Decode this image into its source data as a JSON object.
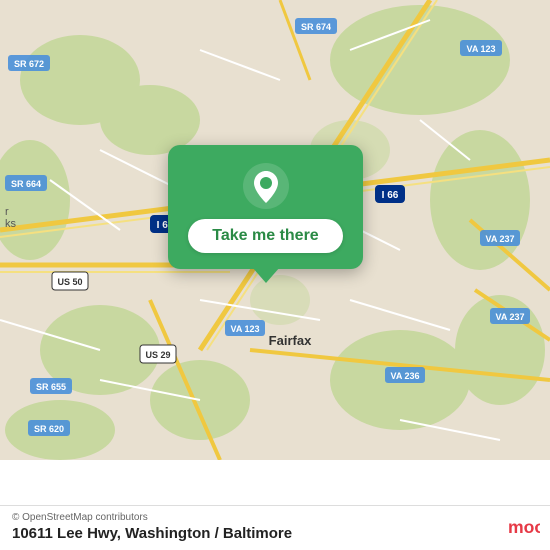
{
  "map": {
    "background_color": "#e8e0d0",
    "alt": "Map of Fairfax VA area showing 10611 Lee Hwy"
  },
  "popup": {
    "button_label": "Take me there",
    "pin_color": "#ffffff"
  },
  "bottom_bar": {
    "attribution": "© OpenStreetMap contributors",
    "address": "10611 Lee Hwy,",
    "city": "Washington / Baltimore"
  },
  "moovit": {
    "label": "moovit"
  }
}
